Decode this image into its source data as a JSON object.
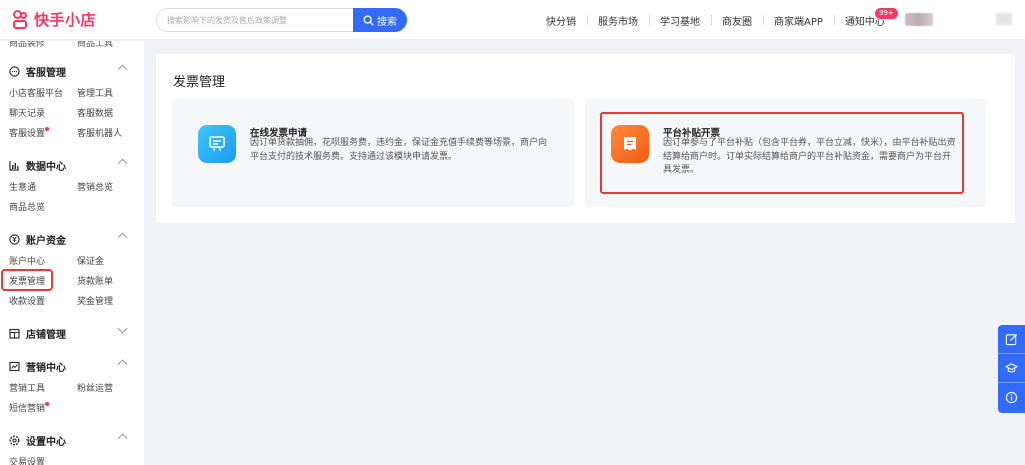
{
  "header": {
    "logo_text": "快手小店",
    "search_placeholder": "搜索影响下的发货及售后政策调整",
    "search_button": "搜索",
    "nav": [
      "快分销",
      "服务市场",
      "学习基地",
      "商友圈",
      "商家端APP",
      "通知中心"
    ],
    "notify_badge": "99+"
  },
  "sidebar": {
    "cut_top_left": "商品装修",
    "cut_top_right": "商品工具",
    "sections": [
      {
        "title": "客服管理",
        "icon": "chat-icon",
        "expanded": true,
        "items": [
          "小店客服平台",
          "管理工具",
          "聊天记录",
          "客服数据",
          "客服设置",
          "客服机器人"
        ]
      },
      {
        "title": "数据中心",
        "icon": "bar-chart-icon",
        "expanded": true,
        "items": [
          "生意通",
          "营销总览",
          "商品总览"
        ]
      },
      {
        "title": "账户资金",
        "icon": "yen-icon",
        "expanded": true,
        "items": [
          "账户中心",
          "保证金",
          "发票管理",
          "货款账单",
          "收款设置",
          "奖金管理"
        ]
      },
      {
        "title": "店铺管理",
        "icon": "store-icon",
        "expanded": false,
        "items": []
      },
      {
        "title": "营销中心",
        "icon": "trend-icon",
        "expanded": true,
        "items": [
          "营销工具",
          "粉丝运营",
          "短信营销"
        ]
      },
      {
        "title": "设置中心",
        "icon": "gear-icon",
        "expanded": true,
        "items": [
          "交易设置"
        ]
      }
    ]
  },
  "main": {
    "title": "发票管理",
    "cards": [
      {
        "title": "在线发票申请",
        "desc": "因订单货款抽佣，花呗服务费，违约金，保证金充值手续费等场景，商户向平台支付的技术服务费。支持通过该模块申请发票。",
        "icon": "invoice-icon",
        "accent": "#1c9bf2"
      },
      {
        "title": "平台补贴开票",
        "desc": "因订单参与了平台补贴（包含平台券，平台立减，快米），由平台补贴出资结算给商户时。订单实际结算给商户的平台补贴资金，需要商户为平台开具发票。",
        "icon": "receipt-icon",
        "accent": "#f25d14"
      }
    ]
  },
  "float_tools": [
    "edit-icon",
    "graduation-icon",
    "info-icon"
  ],
  "colors": {
    "brand": "#fe3666",
    "primary": "#326bfb",
    "highlight": "#e8393a"
  }
}
